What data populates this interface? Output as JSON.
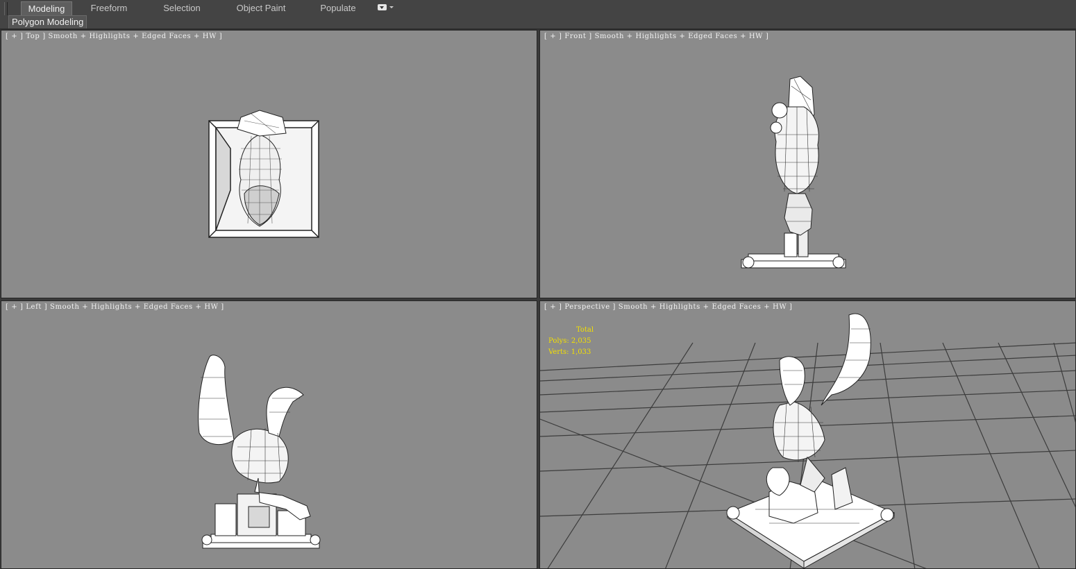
{
  "ribbon": {
    "tabs": [
      {
        "label": "Modeling",
        "active": true
      },
      {
        "label": "Freeform",
        "active": false
      },
      {
        "label": "Selection",
        "active": false
      },
      {
        "label": "Object Paint",
        "active": false
      },
      {
        "label": "Populate",
        "active": false
      }
    ],
    "panel_label": "Polygon Modeling",
    "dropdown_icon": "dropdown-arrow-icon"
  },
  "viewports": {
    "top": {
      "label": "[ + ] Top ] Smooth + Highlights + Edged Faces + HW ]"
    },
    "front": {
      "label": "[ + ] Front ] Smooth + Highlights + Edged Faces + HW ]"
    },
    "left": {
      "label": "[ + ] Left ] Smooth + Highlights + Edged Faces + HW ]"
    },
    "perspective": {
      "label": "[ + ] Perspective ] Smooth + Highlights + Edged Faces + HW ]"
    }
  },
  "statistics": {
    "total_label": "Total",
    "polys": "Polys: 2,035",
    "verts": "Verts: 1,033"
  },
  "colors": {
    "viewport_bg": "#8b8b8b",
    "ui_bg": "#444444",
    "stats_text": "#f4e000",
    "grid_line": "#3c3c3c"
  }
}
